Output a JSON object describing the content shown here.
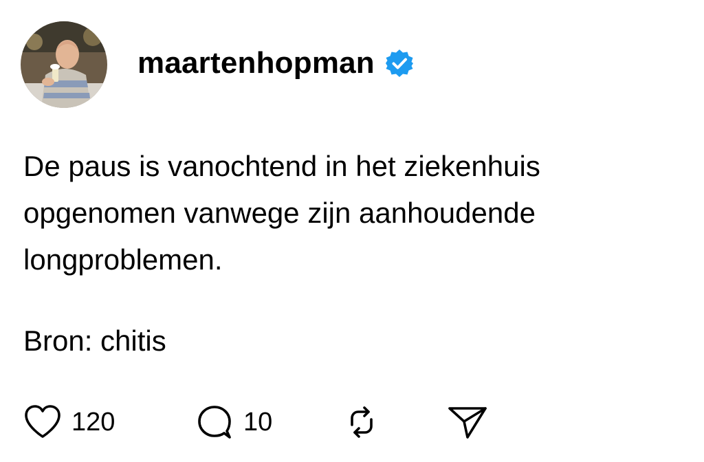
{
  "post": {
    "username": "maartenhopman",
    "verified": true,
    "text_lines": [
      "De paus is vanochtend in het ziekenhuis",
      "opgenomen vanwege zijn aanhoudende",
      "longproblemen."
    ],
    "source": "Bron: chitis"
  },
  "actions": {
    "like_count": "120",
    "reply_count": "10",
    "like_icon": "heart-icon",
    "reply_icon": "speech-bubble-icon",
    "repost_icon": "repost-icon",
    "share_icon": "paper-plane-icon"
  },
  "colors": {
    "verified_badge": "#1d9bf0",
    "text": "#000000",
    "background": "#ffffff"
  }
}
